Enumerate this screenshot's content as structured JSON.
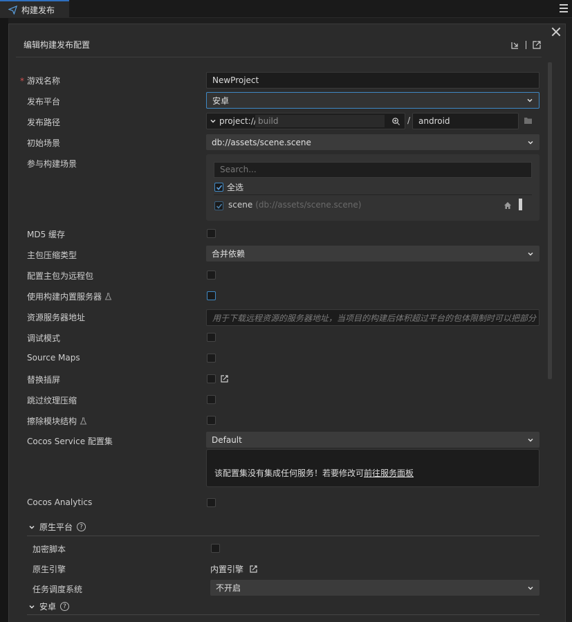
{
  "tab": {
    "label": "构建发布"
  },
  "panel": {
    "title": "编辑构建发布配置"
  },
  "form": {
    "game_name": {
      "label": "游戏名称",
      "value": "NewProject"
    },
    "platform": {
      "label": "发布平台",
      "value": "安卓"
    },
    "build_path": {
      "label": "发布路径",
      "protocol": "project://",
      "placeholder": "build",
      "separator": "/",
      "subfolder": "android"
    },
    "start_scene": {
      "label": "初始场景",
      "value": "db://assets/scene.scene"
    },
    "scenes": {
      "label": "参与构建场景",
      "search_placeholder": "Search...",
      "select_all": "全选",
      "items": [
        {
          "name": "scene",
          "path": "(db://assets/scene.scene)"
        }
      ]
    },
    "md5": {
      "label": "MD5 缓存"
    },
    "compression": {
      "label": "主包压缩类型",
      "value": "合并依赖"
    },
    "main_remote": {
      "label": "配置主包为远程包"
    },
    "builtin_server": {
      "label": "使用构建内置服务器"
    },
    "server_address": {
      "label": "资源服务器地址",
      "placeholder": "用于下载远程资源的服务器地址，当项目的构建后体积超过平台的包体限制时可以把部分"
    },
    "debug": {
      "label": "调试模式"
    },
    "source_maps": {
      "label": "Source Maps"
    },
    "splash": {
      "label": "替换插屏"
    },
    "skip_texture": {
      "label": "跳过纹理压缩"
    },
    "erase_module": {
      "label": "擦除模块结构"
    },
    "cocos_service": {
      "label": "Cocos Service 配置集",
      "value": "Default",
      "notice": "该配置集没有集成任何服务！若要修改可",
      "link": "前往服务面板"
    },
    "analytics": {
      "label": "Cocos Analytics"
    }
  },
  "native": {
    "section_title": "原生平台",
    "encrypt": {
      "label": "加密脚本"
    },
    "engine": {
      "label": "原生引擎",
      "value": "内置引擎"
    },
    "scheduler": {
      "label": "任务调度系统",
      "value": "不开启"
    }
  },
  "android": {
    "section_title": "安卓"
  },
  "colors": {
    "accent": "#3f89c5",
    "background": "#2b2b2b",
    "required": "#d05050"
  }
}
